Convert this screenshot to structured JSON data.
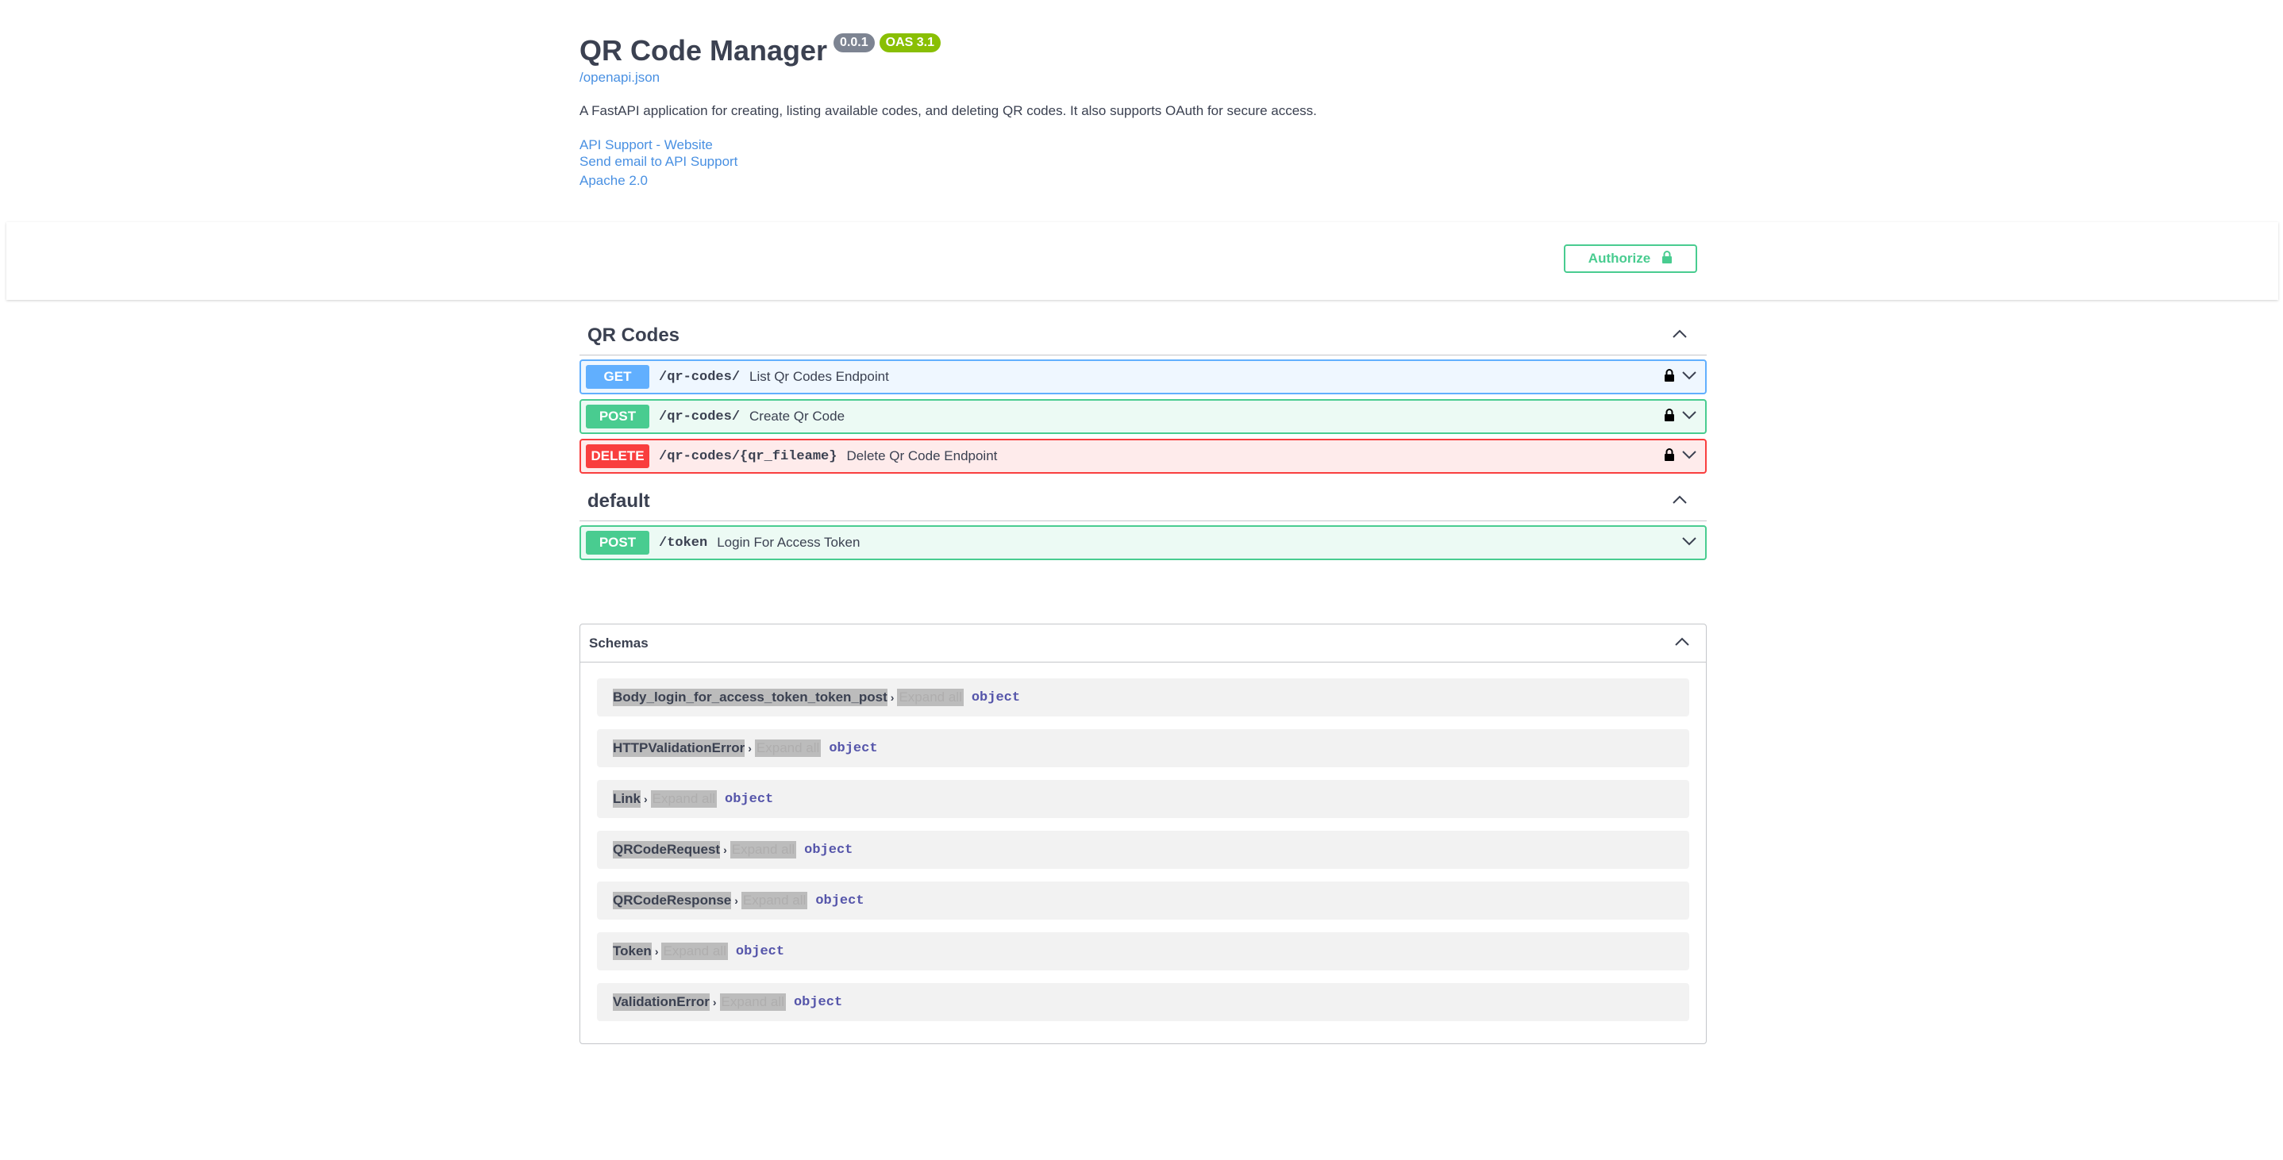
{
  "info": {
    "title": "QR Code Manager",
    "version_badge": "0.0.1",
    "oas_badge": "OAS 3.1",
    "spec_link": "/openapi.json",
    "description": "A FastAPI application for creating, listing available codes, and deleting QR codes. It also supports OAuth for secure access.",
    "links": {
      "website": "API Support - Website",
      "email": "Send email to API Support",
      "license": "Apache 2.0"
    }
  },
  "scheme": {
    "authorize_label": "Authorize",
    "icon": "lock-icon"
  },
  "tags": [
    {
      "name": "QR Codes",
      "operations": [
        {
          "method": "GET",
          "path": "/qr-codes/",
          "summary": "List Qr Codes Endpoint",
          "locked": true
        },
        {
          "method": "POST",
          "path": "/qr-codes/",
          "summary": "Create Qr Code",
          "locked": true
        },
        {
          "method": "DELETE",
          "path": "/qr-codes/{qr_fileame}",
          "summary": "Delete Qr Code Endpoint",
          "locked": true
        }
      ]
    },
    {
      "name": "default",
      "operations": [
        {
          "method": "POST",
          "path": "/token",
          "summary": "Login For Access Token",
          "locked": false
        }
      ]
    }
  ],
  "schemas": {
    "title": "Schemas",
    "expand_label": "Expand all",
    "items": [
      {
        "name": "Body_login_for_access_token_token_post",
        "type": "object"
      },
      {
        "name": "HTTPValidationError",
        "type": "object"
      },
      {
        "name": "Link",
        "type": "object"
      },
      {
        "name": "QRCodeRequest",
        "type": "object"
      },
      {
        "name": "QRCodeResponse",
        "type": "object"
      },
      {
        "name": "Token",
        "type": "object"
      },
      {
        "name": "ValidationError",
        "type": "object"
      }
    ]
  },
  "colors": {
    "get": "#61affe",
    "post": "#49cc90",
    "delete": "#f93e3e",
    "link": "#4990e2",
    "version_badge": "#7d8492",
    "oas_badge": "#89bf04"
  }
}
